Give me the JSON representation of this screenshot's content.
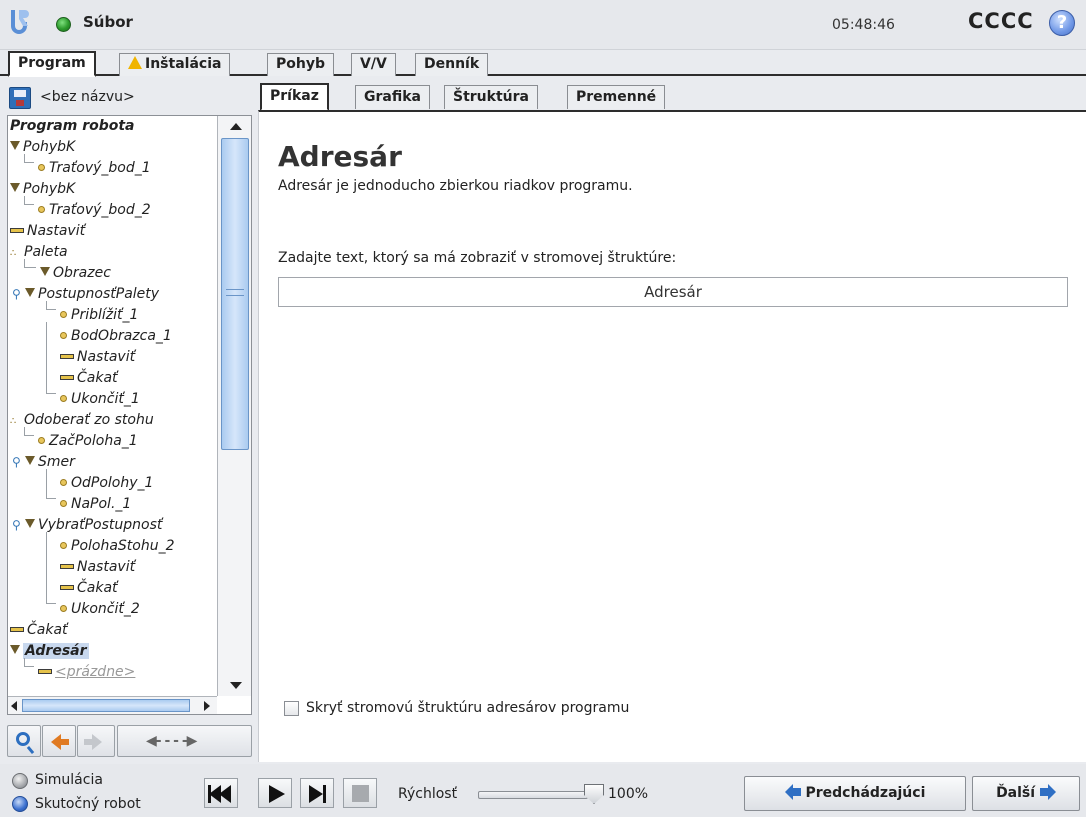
{
  "header": {
    "file_menu": "Súbor",
    "clock": "05:48:46",
    "robot_name": "CCCC",
    "help": "?"
  },
  "top_tabs": [
    {
      "label": "Program",
      "active": true
    },
    {
      "label": "Inštalácia",
      "warning": true
    },
    {
      "label": "Pohyb"
    },
    {
      "label": "V/V"
    },
    {
      "label": "Denník"
    }
  ],
  "left": {
    "program_name": "<bez názvu>",
    "tree": [
      {
        "label": "Program robota"
      },
      {
        "label": "PohybK"
      },
      {
        "label": "Traťový_bod_1"
      },
      {
        "label": "PohybK"
      },
      {
        "label": "Traťový_bod_2"
      },
      {
        "label": "Nastaviť"
      },
      {
        "label": "Paleta"
      },
      {
        "label": "Obrazec"
      },
      {
        "label": "PostupnosťPalety"
      },
      {
        "label": "Priblížiť_1"
      },
      {
        "label": "BodObrazca_1"
      },
      {
        "label": "Nastaviť"
      },
      {
        "label": "Čakať"
      },
      {
        "label": "Ukončiť_1"
      },
      {
        "label": "Odoberať zo stohu"
      },
      {
        "label": "ZačPoloha_1"
      },
      {
        "label": "Smer"
      },
      {
        "label": "OdPolohy_1"
      },
      {
        "label": "NaPol._1"
      },
      {
        "label": "VybraťPostupnosť"
      },
      {
        "label": "PolohaStohu_2"
      },
      {
        "label": "Nastaviť"
      },
      {
        "label": "Čakať"
      },
      {
        "label": "Ukončiť_2"
      },
      {
        "label": "Čakať"
      },
      {
        "label": "Adresár",
        "selected": true
      },
      {
        "label": "<prázdne>"
      }
    ]
  },
  "sub_tabs": [
    {
      "label": "Príkaz",
      "active": true
    },
    {
      "label": "Grafika"
    },
    {
      "label": "Štruktúra"
    },
    {
      "label": "Premenné"
    }
  ],
  "content": {
    "title": "Adresár",
    "description": "Adresár je jednoducho zbierkou riadkov programu.",
    "prompt": "Zadajte text, ktorý sa má zobraziť v stromovej štruktúre:",
    "input_value": "Adresár",
    "checkbox_label": "Skryť stromovú štruktúru adresárov programu",
    "checkbox_checked": false
  },
  "footer": {
    "simulation": "Simulácia",
    "real_robot": "Skutočný robot",
    "speed_label": "Rýchlosť",
    "speed_value": "100%",
    "speed_fraction": 1.0,
    "prev": "Predchádzajúci",
    "next": "Ďalší"
  },
  "colors": {
    "accent_blue": "#2f6fc4",
    "selection": "#c8d8ee",
    "status_green": "#2c9a2c"
  }
}
